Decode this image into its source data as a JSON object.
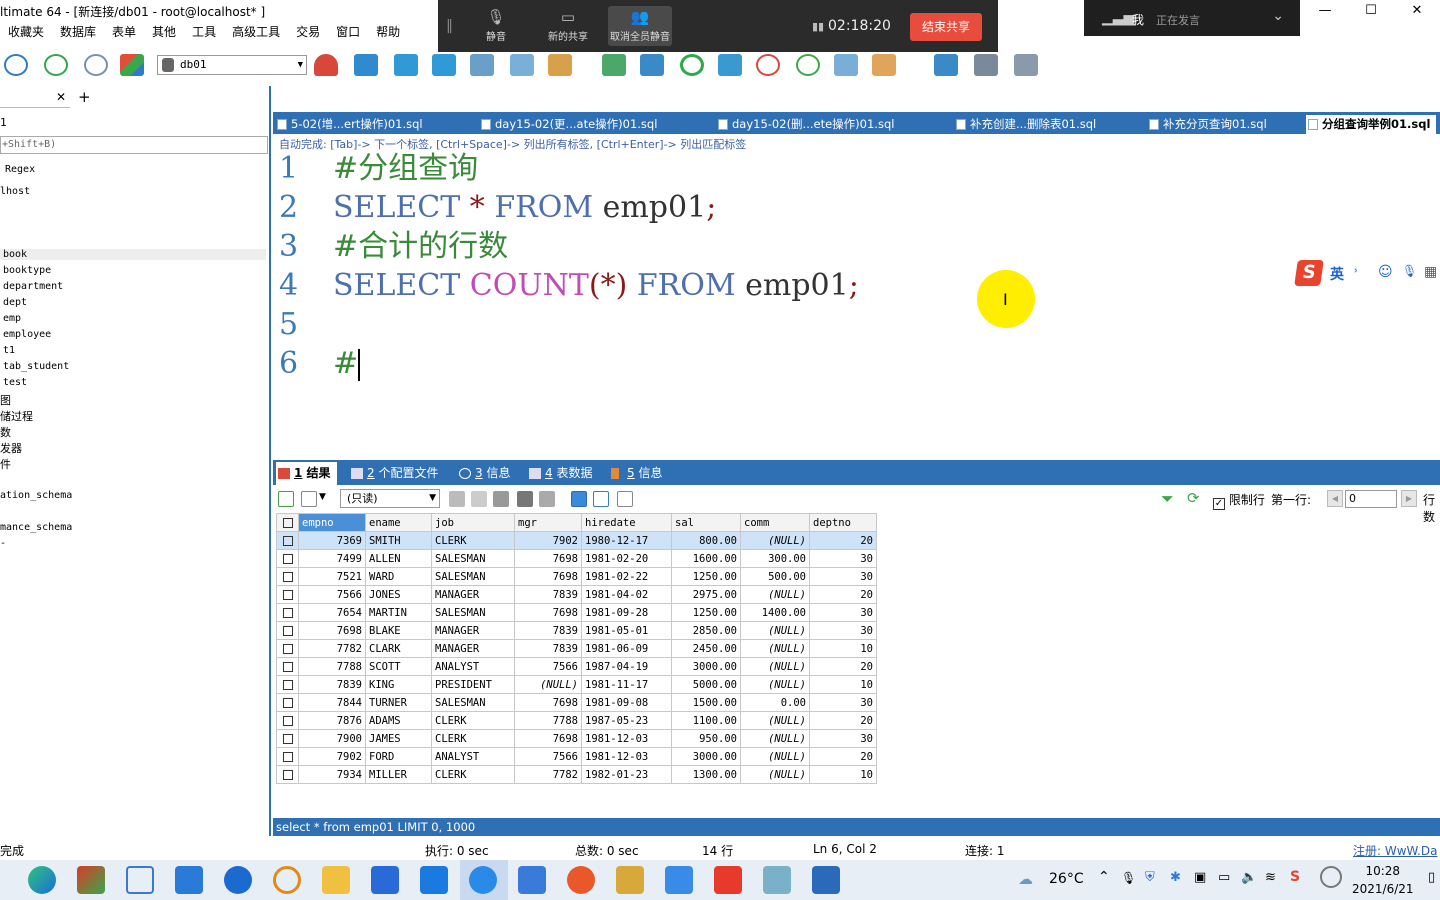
{
  "window": {
    "title": "ltimate 64 - [新连接/db01 - root@localhost* ]",
    "controls": {
      "minimize": "—",
      "maximize": "☐",
      "close": "✕"
    }
  },
  "menu": [
    "收藏夹",
    "数据库",
    "表单",
    "其他",
    "工具",
    "高级工具",
    "交易",
    "窗口",
    "帮助"
  ],
  "meeting": {
    "mute": "静音",
    "new_share": "新的共享",
    "mute_all": "取消全员静音",
    "timer": "02:18:20",
    "end_share": "结束共享",
    "speaker_me": "我",
    "speaker_status": "正在发言"
  },
  "toolbar": {
    "database": "db01"
  },
  "left_panel": {
    "line1": "1",
    "filter_hint": "+Shift+B)",
    "regex": "Regex",
    "host": "lhost",
    "tables": [
      "book",
      "booktype",
      "department",
      "dept",
      "emp",
      "employee",
      "t1",
      "tab_student",
      "test"
    ],
    "groups": [
      "图",
      "储过程",
      "数",
      "发器",
      "件"
    ],
    "schemas": [
      "ation_schema",
      "mance_schema"
    ],
    "dash": "-"
  },
  "editor_tabs": [
    {
      "label": "5-02(增...ert操作)01.sql"
    },
    {
      "label": "day15-02(更...ate操作)01.sql"
    },
    {
      "label": "day15-02(删...ete操作)01.sql"
    },
    {
      "label": "补充创建...删除表01.sql"
    },
    {
      "label": "补充分页查询01.sql"
    },
    {
      "label": "分组查询举例01.sql"
    }
  ],
  "autocomplete_hint": "自动完成: [Tab]-> 下一个标签, [Ctrl+Space]-> 列出所有标签, [Ctrl+Enter]-> 列出匹配标签",
  "code": {
    "l1": {
      "n": "1",
      "comment": "#分组查询"
    },
    "l2": {
      "n": "2",
      "kw1": "SELECT",
      "star": "*",
      "kw2": "FROM",
      "tbl": "emp01",
      "semi": ";"
    },
    "l3": {
      "n": "3",
      "comment": "#合计的行数"
    },
    "l4": {
      "n": "4",
      "kw1": "SELECT",
      "fn": "COUNT",
      "args": "(*)",
      "kw2": "FROM",
      "tbl": "emp01",
      "semi": ";"
    },
    "l5": {
      "n": "5"
    },
    "l6": {
      "n": "6",
      "comment": "#"
    }
  },
  "ime": {
    "logo": "S",
    "lang": "英",
    "punct": "˒",
    "emoji": "☺",
    "mic": "🎙",
    "kbd": "▦"
  },
  "result_tabs": [
    {
      "num": "1",
      "label": "结果"
    },
    {
      "num": "2",
      "label": "个配置文件"
    },
    {
      "num": "3",
      "label": "信息"
    },
    {
      "num": "4",
      "label": "表数据"
    },
    {
      "num": "5",
      "label": "信息"
    }
  ],
  "result_toolbar": {
    "readonly": "(只读)",
    "limit_label": "限制行",
    "first_row_label": "第一行:",
    "first_row_value": "0",
    "rows_label": "行数"
  },
  "grid": {
    "columns": [
      "empno",
      "ename",
      "job",
      "mgr",
      "hiredate",
      "sal",
      "comm",
      "deptno"
    ],
    "rows": [
      [
        "7369",
        "SMITH",
        "CLERK",
        "7902",
        "1980-12-17",
        "800.00",
        "(NULL)",
        "20"
      ],
      [
        "7499",
        "ALLEN",
        "SALESMAN",
        "7698",
        "1981-02-20",
        "1600.00",
        "300.00",
        "30"
      ],
      [
        "7521",
        "WARD",
        "SALESMAN",
        "7698",
        "1981-02-22",
        "1250.00",
        "500.00",
        "30"
      ],
      [
        "7566",
        "JONES",
        "MANAGER",
        "7839",
        "1981-04-02",
        "2975.00",
        "(NULL)",
        "20"
      ],
      [
        "7654",
        "MARTIN",
        "SALESMAN",
        "7698",
        "1981-09-28",
        "1250.00",
        "1400.00",
        "30"
      ],
      [
        "7698",
        "BLAKE",
        "MANAGER",
        "7839",
        "1981-05-01",
        "2850.00",
        "(NULL)",
        "30"
      ],
      [
        "7782",
        "CLARK",
        "MANAGER",
        "7839",
        "1981-06-09",
        "2450.00",
        "(NULL)",
        "10"
      ],
      [
        "7788",
        "SCOTT",
        "ANALYST",
        "7566",
        "1987-04-19",
        "3000.00",
        "(NULL)",
        "20"
      ],
      [
        "7839",
        "KING",
        "PRESIDENT",
        "(NULL)",
        "1981-11-17",
        "5000.00",
        "(NULL)",
        "10"
      ],
      [
        "7844",
        "TURNER",
        "SALESMAN",
        "7698",
        "1981-09-08",
        "1500.00",
        "0.00",
        "30"
      ],
      [
        "7876",
        "ADAMS",
        "CLERK",
        "7788",
        "1987-05-23",
        "1100.00",
        "(NULL)",
        "20"
      ],
      [
        "7900",
        "JAMES",
        "CLERK",
        "7698",
        "1981-12-03",
        "950.00",
        "(NULL)",
        "30"
      ],
      [
        "7902",
        "FORD",
        "ANALYST",
        "7566",
        "1981-12-03",
        "3000.00",
        "(NULL)",
        "20"
      ],
      [
        "7934",
        "MILLER",
        "CLERK",
        "7782",
        "1982-01-23",
        "1300.00",
        "(NULL)",
        "10"
      ]
    ]
  },
  "result_status": "select * from emp01 LIMIT 0, 1000",
  "statusbar": {
    "state": "完成",
    "exec": "执行: 0 sec",
    "total": "总数: 0 sec",
    "rows": "14 行",
    "position": "Ln 6, Col 2",
    "connection": "连接: 1",
    "register": "注册: WwW.Da"
  },
  "taskbar": {
    "temperature": "26°C",
    "time": "10:28",
    "date": "2021/6/21"
  },
  "colors": {
    "accent": "#2f6fb3",
    "end_share": "#e84c3d",
    "pointer": "#ffee00",
    "keyword": "#4d6fb0",
    "comment": "#3a8a3a",
    "function": "#c24cb5"
  }
}
